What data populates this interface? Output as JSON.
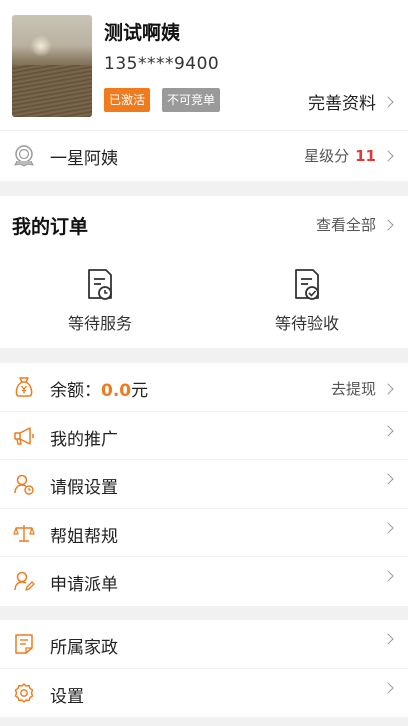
{
  "profile": {
    "name": "测试啊姨",
    "phone": "135****9400",
    "badge_active": "已激活",
    "badge_no_compete": "不可竞单",
    "complete_label": "完善资料"
  },
  "star": {
    "label": "一星阿姨",
    "score_label": "星级分",
    "score_value": "11"
  },
  "orders": {
    "title": "我的订单",
    "view_all": "查看全部",
    "items": [
      {
        "label": "等待服务",
        "icon": "document-clock-icon"
      },
      {
        "label": "等待验收",
        "icon": "document-check-icon"
      }
    ]
  },
  "menu1": [
    {
      "label": "余额：",
      "value": "0.0",
      "unit": "元",
      "right": "去提现",
      "icon": "money-bag-icon"
    },
    {
      "label": "我的推广",
      "icon": "megaphone-icon"
    },
    {
      "label": "请假设置",
      "icon": "user-leave-icon"
    },
    {
      "label": "帮姐帮规",
      "icon": "scale-icon"
    },
    {
      "label": "申请派单",
      "icon": "user-edit-icon"
    }
  ],
  "menu2": [
    {
      "label": "所属家政",
      "icon": "document-list-icon"
    },
    {
      "label": "设置",
      "icon": "gear-icon"
    }
  ],
  "colors": {
    "accent": "#f07b1d",
    "badge_gray": "#9a9a9a",
    "score_red": "#e23a3a"
  }
}
